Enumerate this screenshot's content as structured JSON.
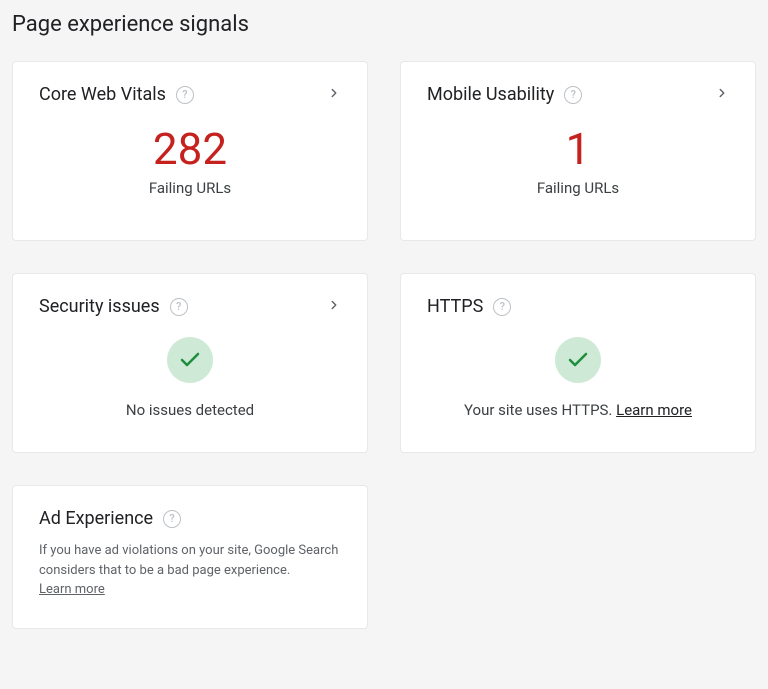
{
  "page_title": "Page experience signals",
  "cards": {
    "core_web_vitals": {
      "title": "Core Web Vitals",
      "value": "282",
      "label": "Failing URLs"
    },
    "mobile_usability": {
      "title": "Mobile Usability",
      "value": "1",
      "label": "Failing URLs"
    },
    "security_issues": {
      "title": "Security issues",
      "status": "No issues detected"
    },
    "https": {
      "title": "HTTPS",
      "status_prefix": "Your site uses HTTPS. ",
      "learn_more": "Learn more"
    },
    "ad_experience": {
      "title": "Ad Experience",
      "description": "If you have ad violations on your site, Google Search considers that to be a bad page experience.",
      "learn_more": "Learn more"
    }
  }
}
